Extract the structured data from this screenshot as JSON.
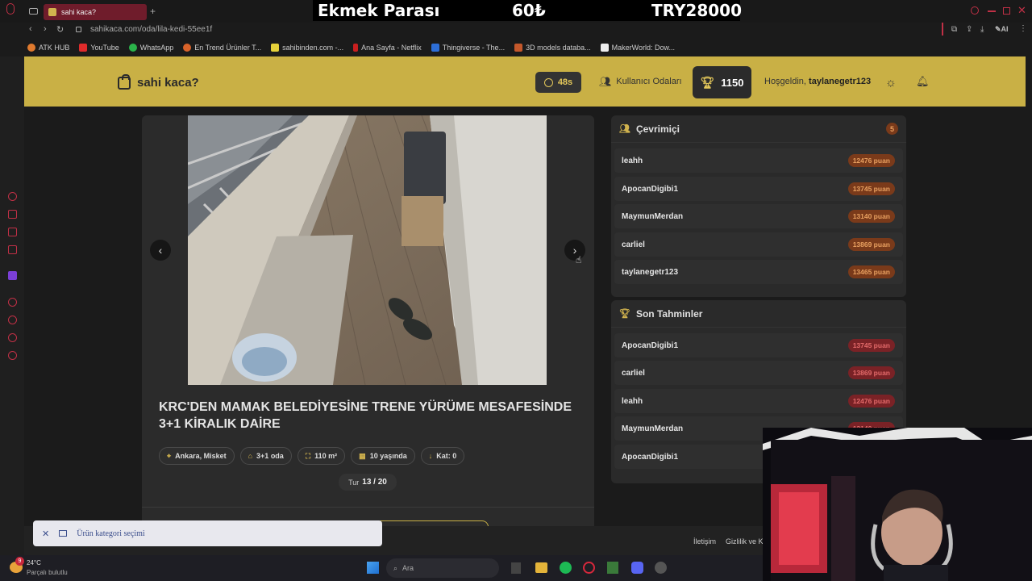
{
  "browser": {
    "tab_title": "sahi kaca?",
    "url": "sahikaca.com/oda/lila-kedi-55ee1f",
    "bookmarks": [
      "ATK HUB",
      "YouTube",
      "WhatsApp",
      "En Trend Ürünler T...",
      "sahibinden.com -...",
      "Ana Sayfa - Netflix",
      "Thingiverse - The...",
      "3D models databa...",
      "MakerWorld: Dow..."
    ]
  },
  "stream_banner": {
    "label": "Ekmek Parası",
    "unit_price": "60₺",
    "total": "TRY28000"
  },
  "header": {
    "logo": "sahi kaca?",
    "timer": "48s",
    "rooms_link": "Kullanıcı Odaları",
    "score": "1150",
    "welcome_prefix": "Hoşgeldin,",
    "username": "taylanegetr123"
  },
  "listing": {
    "title": "KRC'DEN MAMAK BELEDİYESİNE TRENE YÜRÜME MESAFESİNDE 3+1 KİRALIK DAİRE",
    "chips": [
      {
        "icon": "location-pin-icon",
        "label": "Ankara, Misket"
      },
      {
        "icon": "home-icon",
        "label": "3+1 oda"
      },
      {
        "icon": "area-icon",
        "label": "110 m²"
      },
      {
        "icon": "building-icon",
        "label": "10 yaşında"
      },
      {
        "icon": "arrow-down-icon",
        "label": "Kat: 0"
      }
    ],
    "round_label": "Tur",
    "round_value": "13 / 20"
  },
  "online_panel": {
    "title": "Çevrimiçi",
    "count": "5",
    "users": [
      {
        "name": "leahh",
        "points": "12476 puan"
      },
      {
        "name": "ApocanDigibi1",
        "points": "13745 puan"
      },
      {
        "name": "MaymunMerdan",
        "points": "13140 puan"
      },
      {
        "name": "carliel",
        "points": "13869 puan"
      },
      {
        "name": "taylanegetr123",
        "points": "13465 puan"
      }
    ]
  },
  "guesses_panel": {
    "title": "Son Tahminler",
    "guesses": [
      {
        "name": "ApocanDigibi1",
        "points": "13745 puan"
      },
      {
        "name": "carliel",
        "points": "13869 puan"
      },
      {
        "name": "leahh",
        "points": "12476 puan"
      },
      {
        "name": "MaymunMerdan",
        "points": "13140 puan"
      },
      {
        "name": "ApocanDigibi1",
        "points": ""
      }
    ]
  },
  "footer": {
    "links": [
      "İletişim",
      "Gizlilik ve K"
    ]
  },
  "toast": {
    "text": "Ürün kategori seçimi"
  },
  "taskbar": {
    "temperature": "24°C",
    "weather": "Parçalı bulutlu",
    "search_placeholder": "Ara",
    "notification_count": "9"
  },
  "colors": {
    "header_bg": "#c9b045",
    "accent": "#d1b34e",
    "online_badge": "#7a3a1a",
    "guess_badge": "#7a2226"
  }
}
